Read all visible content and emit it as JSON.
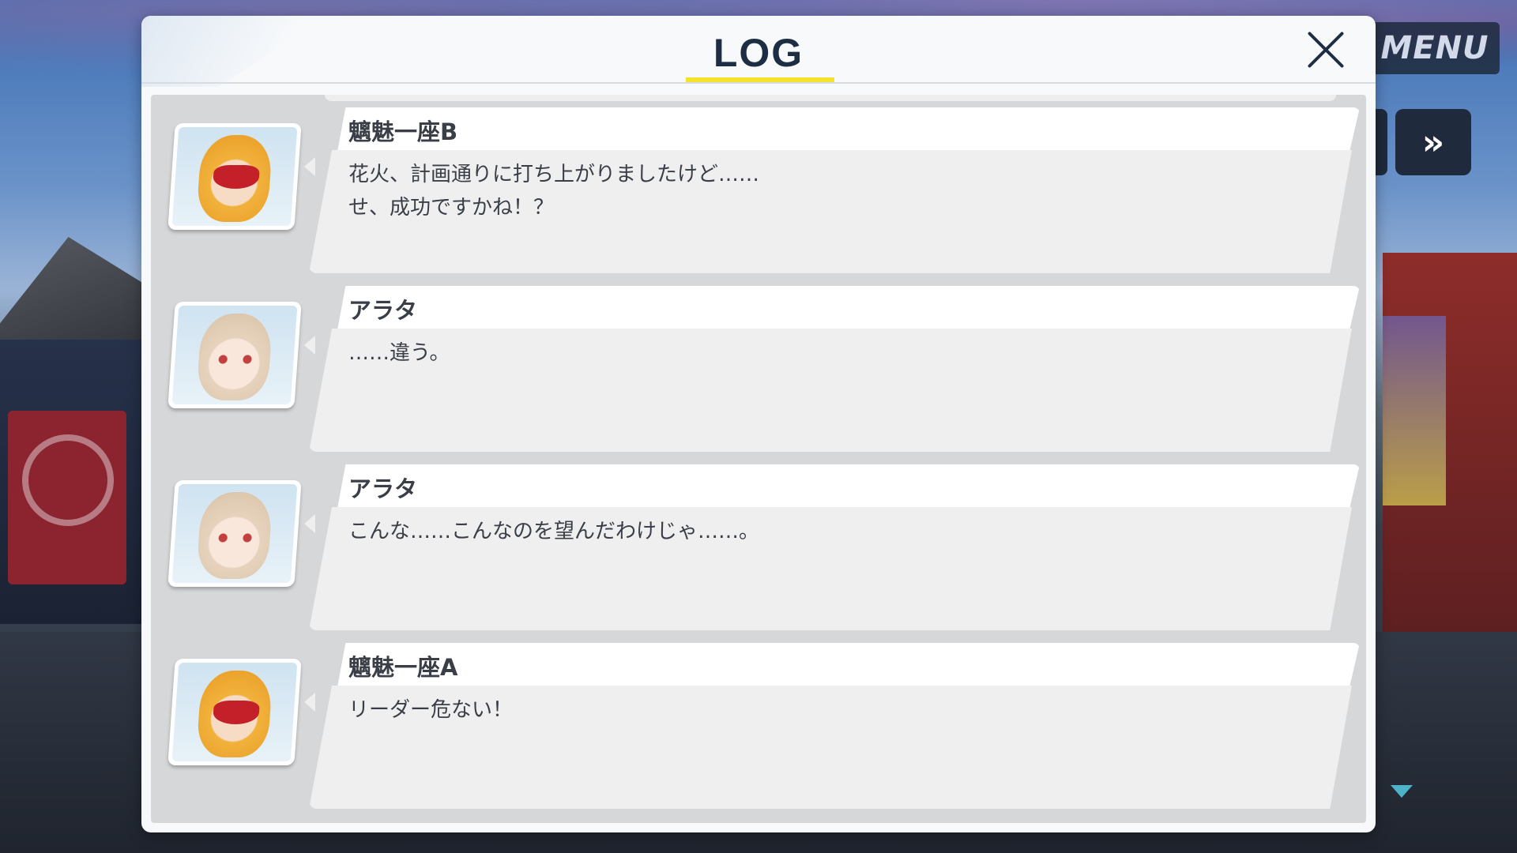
{
  "header": {
    "title": "LOG"
  },
  "controls": {
    "menu_label": "MENU",
    "fast_forward_icon": "double-chevron-right-icon",
    "close_icon": "close-icon",
    "scroll_down_icon": "triangle-down-icon"
  },
  "colors": {
    "accent_underline": "#f5e22a",
    "title_text": "#1d2d44",
    "scroll_indicator": "#4db3c8"
  },
  "log": {
    "entries": [
      {
        "speaker": "魑魅一座B",
        "avatar": "fox-mask-girl-avatar",
        "text": "花火、計画通りに打ち上がりましたけど……\nせ、成功ですかね！？"
      },
      {
        "speaker": "アラタ",
        "avatar": "arata-avatar",
        "text": "……違う。"
      },
      {
        "speaker": "アラタ",
        "avatar": "arata-avatar",
        "text": "こんな……こんなのを望んだわけじゃ……。"
      },
      {
        "speaker": "魑魅一座A",
        "avatar": "fox-mask-girl-avatar",
        "text": "リーダー危ない！"
      }
    ]
  }
}
